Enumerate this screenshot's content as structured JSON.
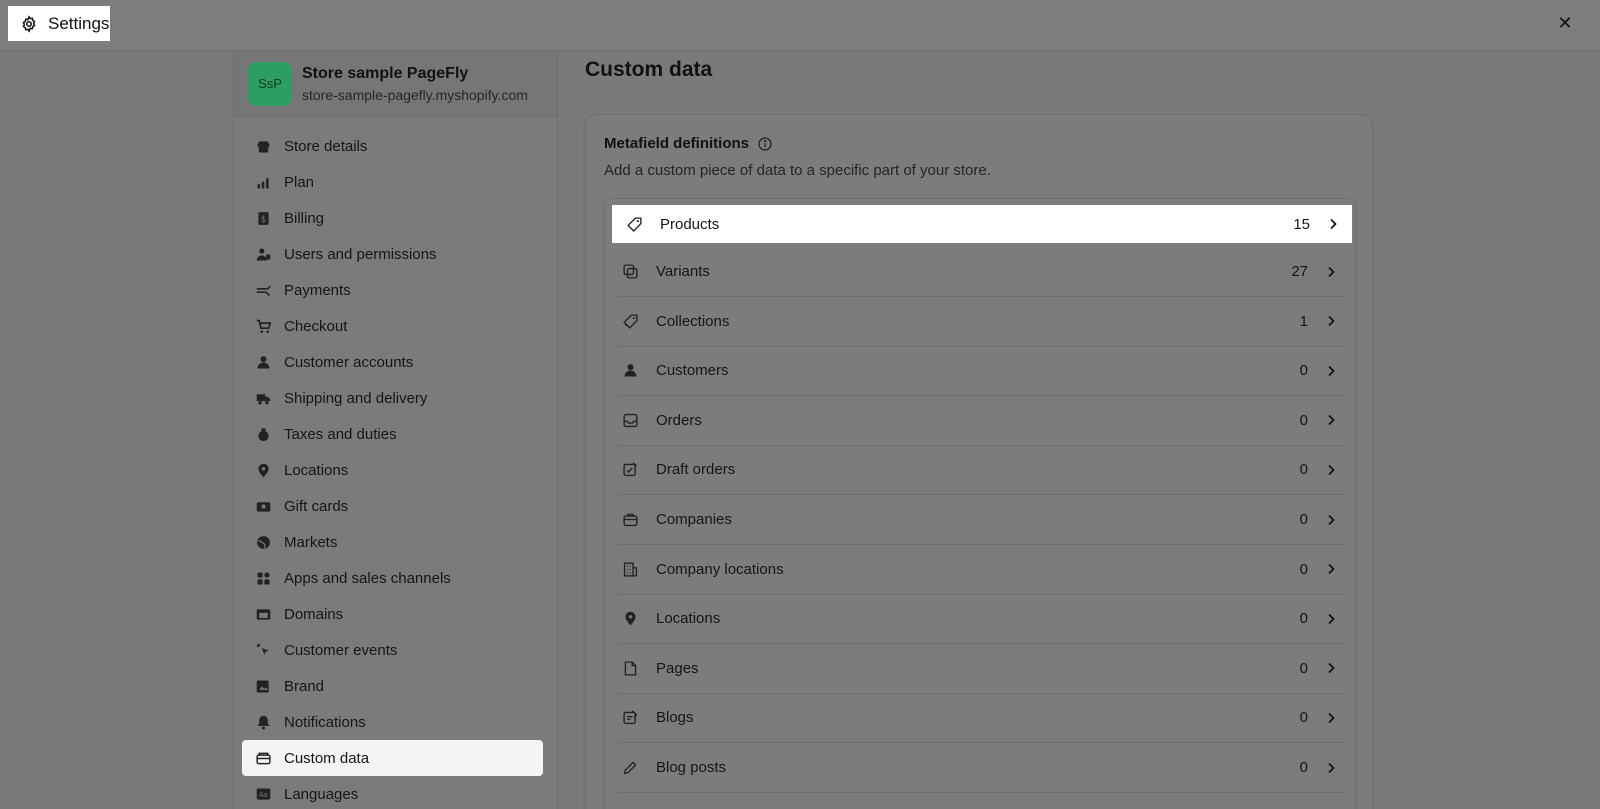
{
  "window": {
    "title": "Settings",
    "close_symbol": "✕"
  },
  "store": {
    "initials": "SsP",
    "name": "Store sample PageFly",
    "url": "store-sample-pagefly.myshopify.com",
    "avatar_color": "#2d9e62"
  },
  "sidebar": {
    "items": [
      {
        "label": "Store details",
        "icon": "store-icon"
      },
      {
        "label": "Plan",
        "icon": "plan-icon"
      },
      {
        "label": "Billing",
        "icon": "billing-icon"
      },
      {
        "label": "Users and permissions",
        "icon": "users-icon"
      },
      {
        "label": "Payments",
        "icon": "payments-icon"
      },
      {
        "label": "Checkout",
        "icon": "cart-icon"
      },
      {
        "label": "Customer accounts",
        "icon": "person-icon"
      },
      {
        "label": "Shipping and delivery",
        "icon": "truck-icon"
      },
      {
        "label": "Taxes and duties",
        "icon": "tax-icon"
      },
      {
        "label": "Locations",
        "icon": "location-icon"
      },
      {
        "label": "Gift cards",
        "icon": "gift-card-icon"
      },
      {
        "label": "Markets",
        "icon": "globe-icon"
      },
      {
        "label": "Apps and sales channels",
        "icon": "apps-icon"
      },
      {
        "label": "Domains",
        "icon": "domains-icon"
      },
      {
        "label": "Customer events",
        "icon": "cursor-icon"
      },
      {
        "label": "Brand",
        "icon": "brand-icon"
      },
      {
        "label": "Notifications",
        "icon": "bell-icon"
      },
      {
        "label": "Custom data",
        "icon": "custom-data-icon",
        "active": true
      },
      {
        "label": "Languages",
        "icon": "languages-icon"
      }
    ]
  },
  "main": {
    "title": "Custom data",
    "card": {
      "title": "Metafield definitions",
      "subtitle": "Add a custom piece of data to a specific part of your store.",
      "rows": [
        {
          "label": "Products",
          "count": "15",
          "icon": "tag-icon"
        },
        {
          "label": "Variants",
          "count": "27",
          "icon": "variants-icon"
        },
        {
          "label": "Collections",
          "count": "1",
          "icon": "collections-icon"
        },
        {
          "label": "Customers",
          "count": "0",
          "icon": "person-icon"
        },
        {
          "label": "Orders",
          "count": "0",
          "icon": "inbox-icon"
        },
        {
          "label": "Draft orders",
          "count": "0",
          "icon": "draft-icon"
        },
        {
          "label": "Companies",
          "count": "0",
          "icon": "briefcase-icon"
        },
        {
          "label": "Company locations",
          "count": "0",
          "icon": "building-icon"
        },
        {
          "label": "Locations",
          "count": "0",
          "icon": "location-icon"
        },
        {
          "label": "Pages",
          "count": "0",
          "icon": "page-icon"
        },
        {
          "label": "Blogs",
          "count": "0",
          "icon": "blog-icon"
        },
        {
          "label": "Blog posts",
          "count": "0",
          "icon": "pencil-icon"
        }
      ]
    }
  }
}
